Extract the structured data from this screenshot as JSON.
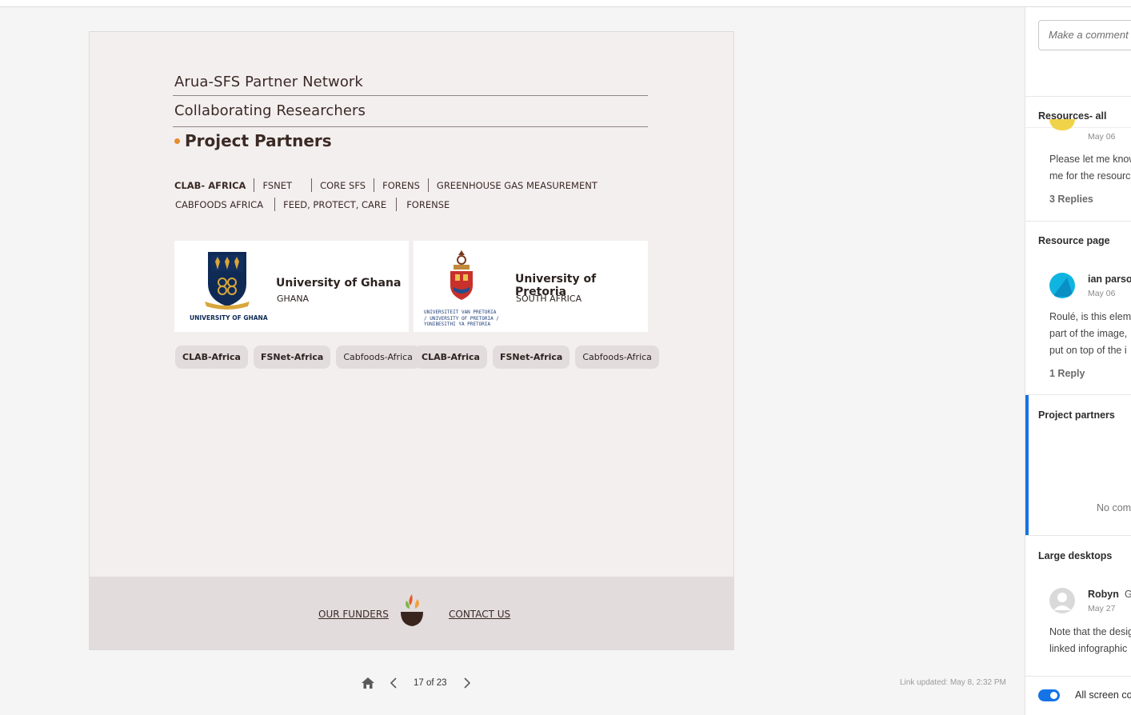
{
  "artboard": {
    "nav": {
      "item1": "Arua-SFS Partner Network",
      "item2": "Collaborating Researchers",
      "section": "Project Partners"
    },
    "filters_row1": [
      "CLAB- AFRICA",
      "FSNET",
      "CORE SFS",
      "FORENS",
      "GREENHOUSE GAS MEASUREMENT"
    ],
    "filters_row2": [
      "CABFOODS AFRICA",
      "FEED, PROTECT, CARE",
      "FORENSE"
    ],
    "partners": [
      {
        "name": "University of Ghana",
        "country": "GHANA",
        "logo_caption": "UNIVERSITY OF GHANA",
        "tags": [
          "CLAB-Africa",
          "FSNet-Africa",
          "Cabfoods-Africa"
        ]
      },
      {
        "name": "University of Pretoria",
        "country": "SOUTH AFRICA",
        "logo_caption": "UNIVERSITEIT VAN PRETORIA / UNIVERSITY OF PRETORIA / YUNIBESITHI YA PRETORIA",
        "tags": [
          "CLAB-Africa",
          "FSNet-Africa",
          "Cabfoods-Africa"
        ]
      }
    ],
    "footer": {
      "funders": "OUR FUNDERS",
      "contact": "CONTACT US"
    }
  },
  "pager": {
    "count": "17 of 23",
    "link_updated": "Link updated: May 8, 2:32 PM"
  },
  "panel": {
    "comment_placeholder": "Make a comment",
    "groups": [
      {
        "title": "Resources- all",
        "date": "May 06",
        "text_lines": [
          "Please let me know",
          "me for the resourc"
        ],
        "replies": "3 Replies"
      },
      {
        "title": "Resource page",
        "author": "ian parso",
        "date": "May 06",
        "text_lines": [
          "Roulé, is this elem",
          "part of the image,",
          "put on top of the i"
        ],
        "replies": "1 Reply"
      },
      {
        "title": "Project partners",
        "empty": "No com"
      },
      {
        "title": "Large desktops",
        "author": "Robyn",
        "author_extra": "G",
        "date": "May 27",
        "text_lines": [
          "Note that the desig",
          "linked infographic"
        ]
      }
    ],
    "toggle_label": "All screen co"
  },
  "colors": {
    "accent": "#1473e6",
    "bullet": "#e88b2c",
    "artboard_bg": "#f4efef",
    "footer_bg": "#e3dcdc"
  },
  "icons": [
    "home-icon",
    "chevron-left-icon",
    "chevron-right-icon",
    "funders-logo-icon"
  ]
}
